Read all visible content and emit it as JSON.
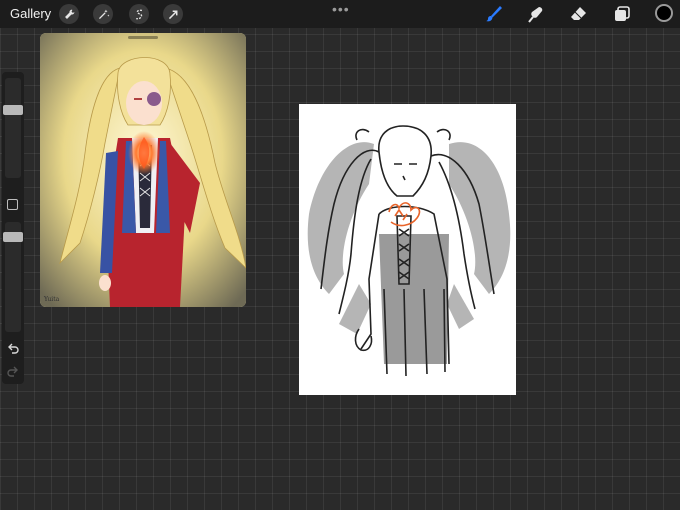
{
  "toolbar": {
    "gallery_label": "Gallery",
    "left_tools": [
      "wrench-icon",
      "magic-wand-icon",
      "selection-icon",
      "transform-arrow-icon"
    ],
    "right_tools": [
      "brush-icon",
      "smudge-icon",
      "eraser-icon",
      "layers-icon"
    ],
    "active_tool": "brush-icon",
    "more_label": "•••",
    "current_color": "#000000",
    "accent": "#2a7bff"
  },
  "sidebar": {
    "brush_size": 0.7,
    "opacity": 0.9,
    "buttons": [
      "undo-icon",
      "redo-icon"
    ]
  },
  "reference": {
    "signature": "Yuita"
  }
}
